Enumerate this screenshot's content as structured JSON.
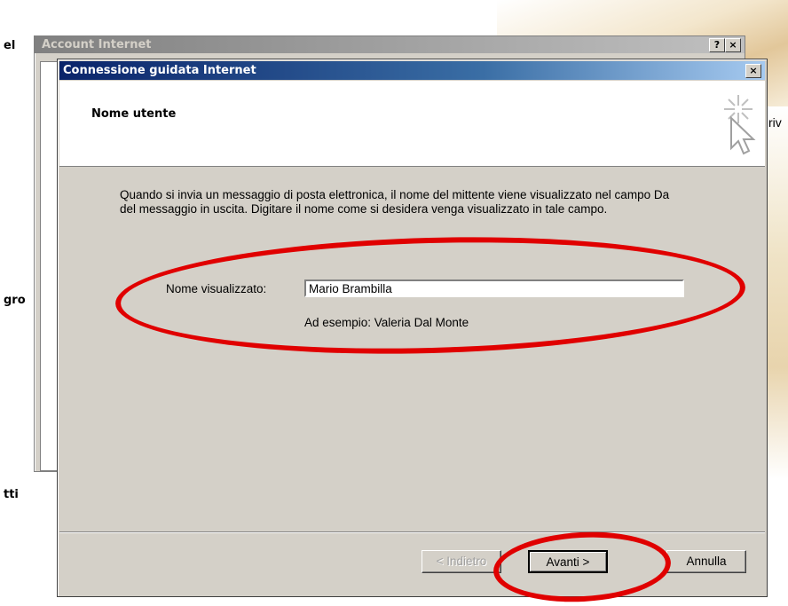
{
  "background": {
    "labels": [
      "el",
      "gro",
      "tti",
      "riv"
    ]
  },
  "back_window": {
    "title": "Account Internet",
    "help_label": "?",
    "close_label": "×"
  },
  "wizard": {
    "title": "Connessione guidata Internet",
    "close_label": "×",
    "header_title": "Nome utente",
    "header_icon": "cursor-sparkle-icon",
    "description": "Quando si invia un messaggio di posta elettronica, il nome del mittente viene visualizzato nel campo Da del messaggio in uscita. Digitare il nome come si desidera venga visualizzato in tale campo.",
    "name_label": "Nome visualizzato:",
    "name_value": "Mario Brambilla",
    "example": "Ad esempio: Valeria Dal Monte",
    "buttons": {
      "back": "< Indietro",
      "next": "Avanti >",
      "cancel": "Annulla"
    }
  },
  "annotation_color": "#e00000"
}
